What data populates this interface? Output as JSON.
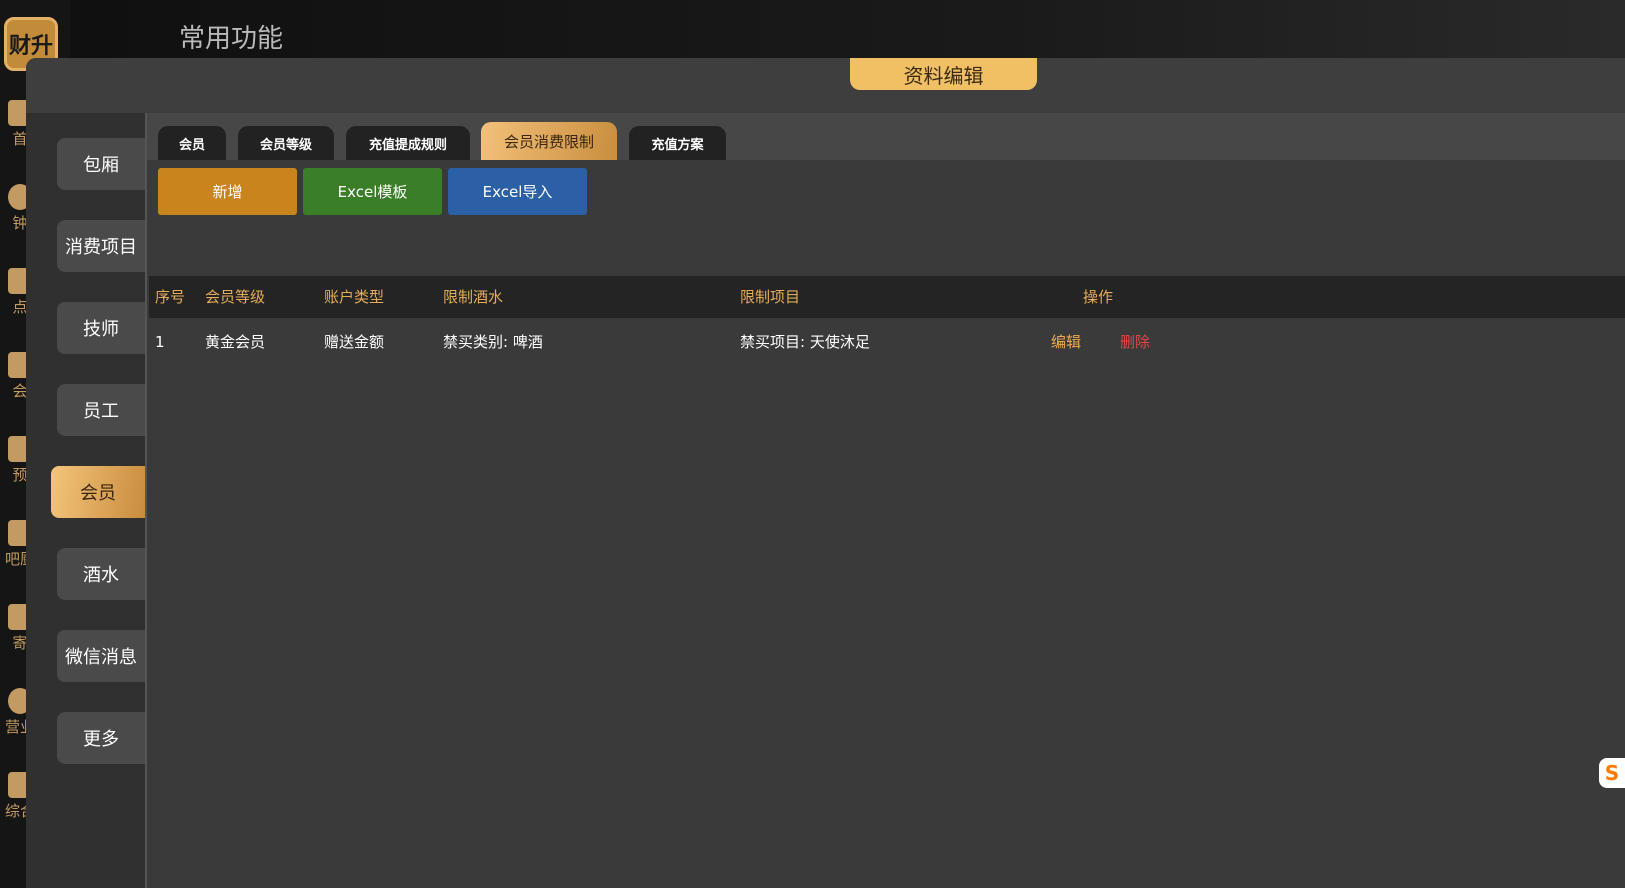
{
  "app": {
    "logo_text": "财升",
    "top_title": "常用功能"
  },
  "rail": {
    "items": [
      {
        "label": "首"
      },
      {
        "label": "钟"
      },
      {
        "label": "点"
      },
      {
        "label": "会"
      },
      {
        "label": "预"
      },
      {
        "label": "吧厨"
      },
      {
        "label": "寄"
      },
      {
        "label": "营业"
      },
      {
        "label": "综合"
      }
    ]
  },
  "panel": {
    "title": "资料编辑"
  },
  "side_nav": {
    "items": [
      {
        "label": "包厢"
      },
      {
        "label": "消费项目"
      },
      {
        "label": "技师"
      },
      {
        "label": "员工"
      },
      {
        "label": "会员",
        "active": true
      },
      {
        "label": "酒水"
      },
      {
        "label": "微信消息"
      },
      {
        "label": "更多"
      }
    ]
  },
  "tabs": [
    {
      "label": "会员"
    },
    {
      "label": "会员等级"
    },
    {
      "label": "充值提成规则"
    },
    {
      "label": "会员消费限制",
      "active": true
    },
    {
      "label": "充值方案"
    }
  ],
  "toolbar": {
    "add_label": "新增",
    "template_label": "Excel模板",
    "import_label": "Excel导入",
    "add_color": "#c9841e",
    "template_color": "#3a7e28",
    "import_color": "#2b5fa6"
  },
  "table": {
    "columns": [
      "序号",
      "会员等级",
      "账户类型",
      "限制酒水",
      "限制项目",
      "操作"
    ],
    "rows": [
      {
        "index": "1",
        "level": "黄金会员",
        "account_type": "赠送金额",
        "drink_limit": "禁买类别: 啤酒",
        "item_limit": "禁买项目: 天使沐足",
        "edit_label": "编辑",
        "delete_label": "删除"
      }
    ]
  },
  "float_tab": {
    "text": "S"
  },
  "colors": {
    "accent_gold": "#f1c064",
    "header_text": "#e5ad57",
    "edit": "#f0a94a",
    "delete": "#e04747"
  }
}
